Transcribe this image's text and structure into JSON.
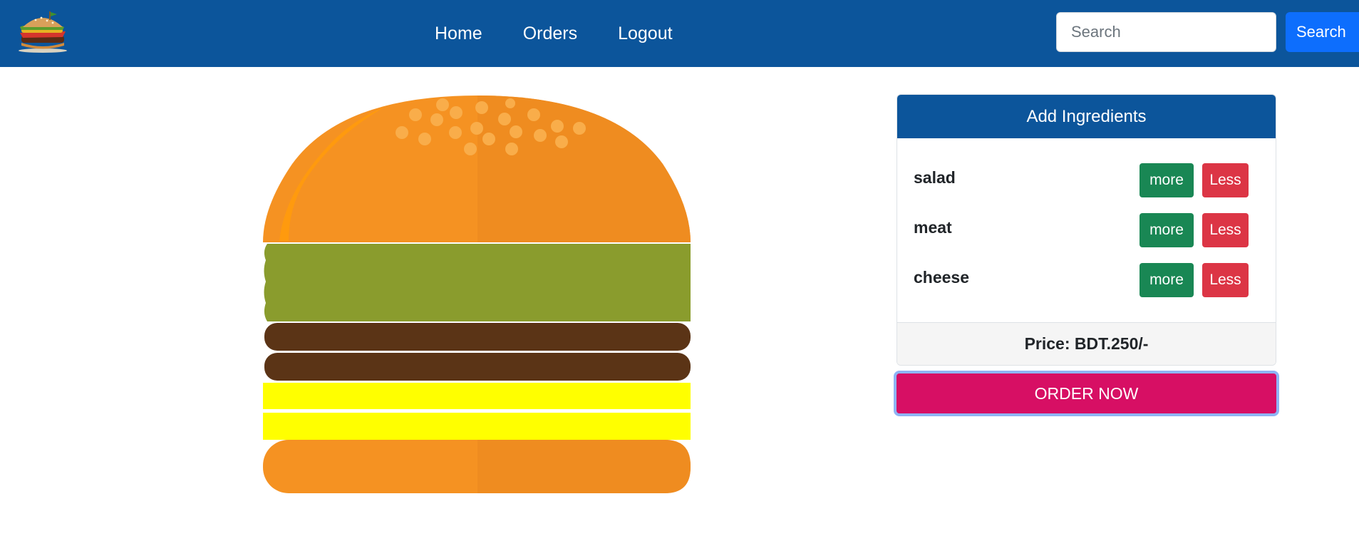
{
  "navbar": {
    "logo_icon": "burger-logo-icon",
    "links": [
      {
        "label": "Home"
      },
      {
        "label": "Orders"
      },
      {
        "label": "Logout"
      }
    ],
    "search": {
      "placeholder": "Search",
      "value": "",
      "button_label": "Search"
    }
  },
  "burger": {
    "layers": [
      "bread-top",
      "salad",
      "meat",
      "meat",
      "cheese",
      "cheese",
      "bread-bottom"
    ],
    "colors": {
      "bread": "#f59222",
      "salad": "#8a9c2d",
      "meat": "#5b3416",
      "cheese": "#ffff00"
    }
  },
  "ingredients_card": {
    "header": "Add Ingredients",
    "items": [
      {
        "label": "salad",
        "more_label": "more",
        "less_label": "Less"
      },
      {
        "label": "meat",
        "more_label": "more",
        "less_label": "Less"
      },
      {
        "label": "cheese",
        "more_label": "more",
        "less_label": "Less"
      }
    ],
    "price": "Price: BDT.250/-"
  },
  "order_button": "ORDER NOW",
  "colors": {
    "nav_bg": "#0c559b",
    "search_button": "#0d6efd",
    "more_button": "#198754",
    "less_button": "#dc3545",
    "order_button": "#d70f64"
  }
}
